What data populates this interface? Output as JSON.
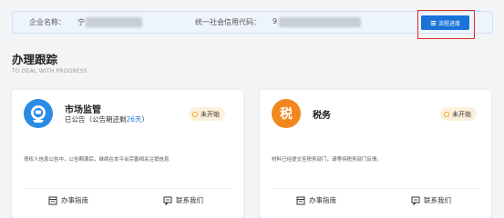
{
  "company": {
    "name_label": "企业名称：",
    "name_value": "宁",
    "credit_label": "统一社会信用代码：",
    "credit_value": "9",
    "progress_button": "流程进度",
    "progress_icon": "list-icon"
  },
  "section": {
    "title": "办理跟踪",
    "subtitle": "TO DEAL WITH PROGRESS"
  },
  "cards": [
    {
      "icon": "shield-badge-icon",
      "icon_color": "#2b8ce5",
      "title": "市场监管",
      "subtitle_prefix": "已公告（公告期还剩",
      "subtitle_days": "26天",
      "subtitle_suffix": "）",
      "status": "未开始",
      "description": "债权人信息公告中，公告期满后，继续在本平台完善相关注销信息",
      "guide_label": "办事指南",
      "contact_label": "联系我们"
    },
    {
      "icon": "tax-icon",
      "icon_glyph": "税",
      "icon_color": "#f2871d",
      "title": "税务",
      "status": "未开始",
      "description": "材料已经提交至税务部门，请等待税务部门反馈。",
      "guide_label": "办事指南",
      "contact_label": "联系我们"
    }
  ],
  "colors": {
    "accent": "#1a73d9",
    "highlight_border": "#e02b2b",
    "status_bg": "#fdf0da",
    "status_dot": "#f2a515"
  }
}
